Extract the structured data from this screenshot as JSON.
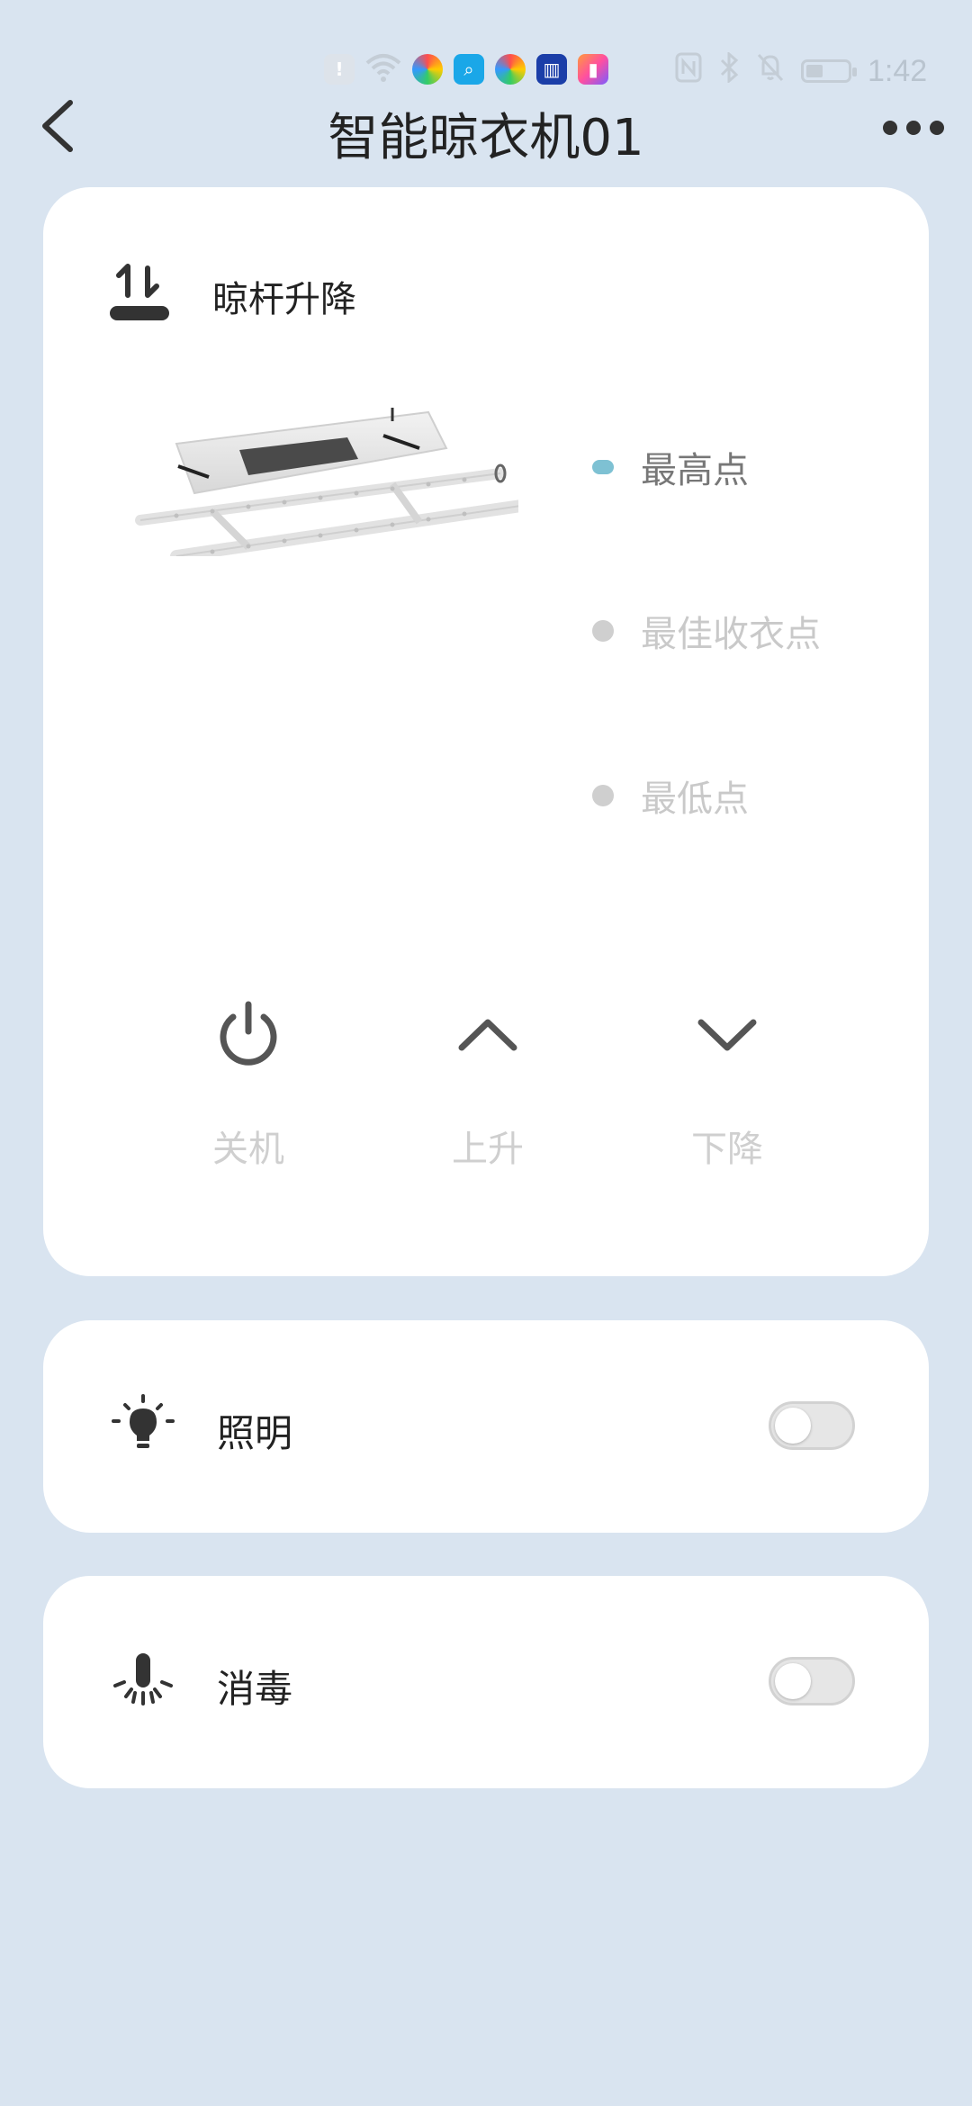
{
  "status_bar": {
    "time": "1:42",
    "app_icons": [
      "alert-icon",
      "wifi-icon",
      "app-colorful-icon",
      "search-app-icon",
      "app-colorful-icon",
      "chart-app-icon",
      "paint-app-icon"
    ],
    "right_icons": [
      "nfc-icon",
      "bluetooth-icon",
      "mute-bell-icon",
      "battery-icon"
    ],
    "battery_level": 0.35
  },
  "header": {
    "title": "智能晾衣机01"
  },
  "lift_section": {
    "title": "晾杆升降",
    "levels": [
      {
        "label": "最高点",
        "active": true
      },
      {
        "label": "最佳收衣点",
        "active": false
      },
      {
        "label": "最低点",
        "active": false
      }
    ],
    "controls": {
      "power_label": "关机",
      "up_label": "上升",
      "down_label": "下降"
    }
  },
  "lighting": {
    "label": "照明",
    "on": false
  },
  "disinfect": {
    "label": "消毒",
    "on": false
  },
  "colors": {
    "background": "#d9e4f0",
    "accent": "#7ec1d3",
    "disabled_text": "#cfcfcf"
  }
}
